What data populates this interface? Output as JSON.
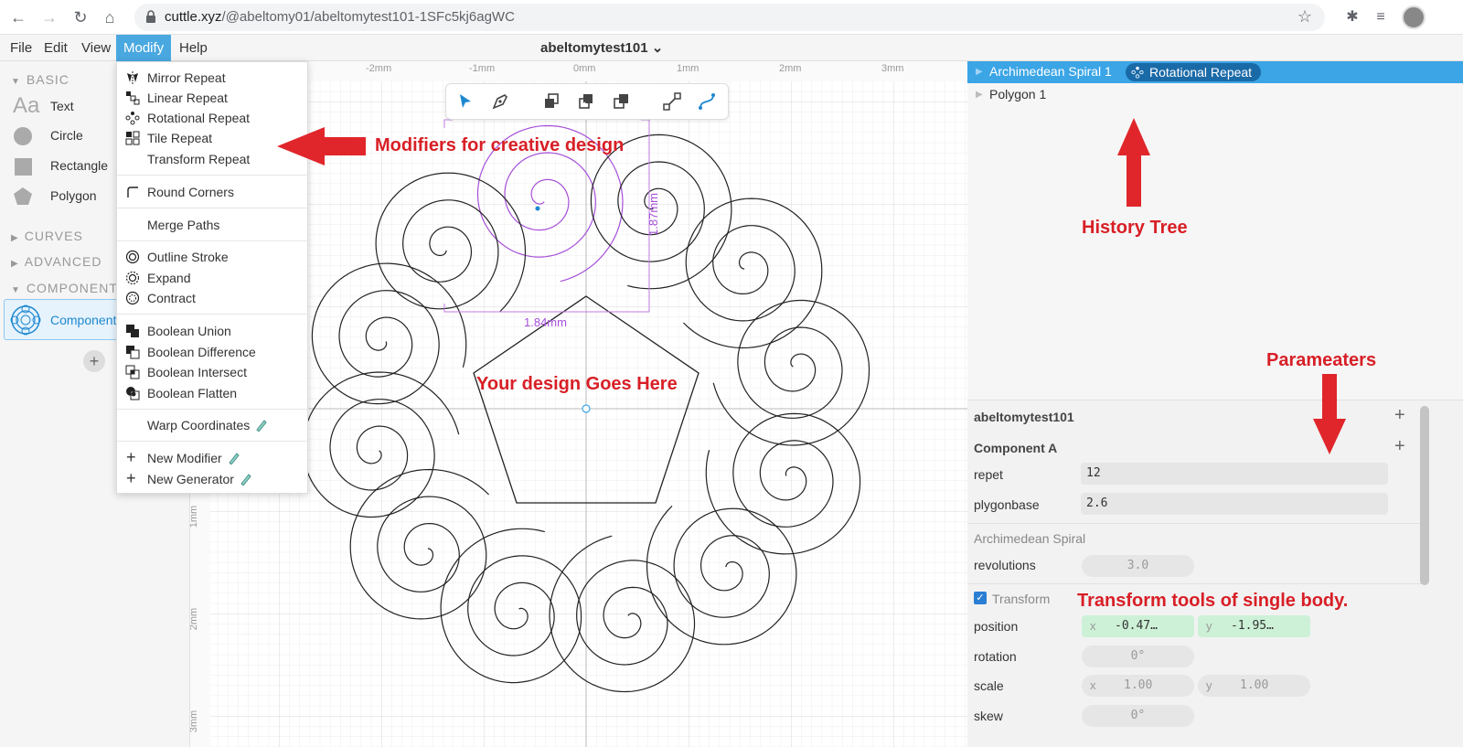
{
  "browser": {
    "url_domain": "cuttle.xyz",
    "url_path": "/@abeltomy01/abeltomytest101-1SFc5kj6agWC"
  },
  "menubar": {
    "items": [
      "File",
      "Edit",
      "View",
      "Modify",
      "Help"
    ],
    "active": "Modify",
    "doc_title": "abeltomytest101",
    "doc_title_chevron": "⌄"
  },
  "left_panel": {
    "basic_header": "BASIC",
    "shapes": [
      "Text",
      "Circle",
      "Rectangle",
      "Polygon"
    ],
    "text_icon": "Aa",
    "curves_header": "CURVES",
    "advanced_header": "ADVANCED",
    "components_header": "COMPONENTS",
    "component_item": "Component A",
    "add_label": "+"
  },
  "modify_menu": {
    "groups": [
      [
        "Mirror Repeat",
        "Linear Repeat",
        "Rotational Repeat",
        "Tile Repeat",
        "Transform Repeat"
      ],
      [
        "Round Corners"
      ],
      [
        "Merge Paths"
      ],
      [
        "Outline Stroke",
        "Expand",
        "Contract"
      ],
      [
        "Boolean Union",
        "Boolean Difference",
        "Boolean Intersect",
        "Boolean Flatten"
      ],
      [
        "Warp Coordinates"
      ],
      [
        "New Modifier",
        "New Generator"
      ]
    ]
  },
  "canvas": {
    "ruler_top": [
      "-2mm",
      "-1mm",
      "0mm",
      "1mm",
      "2mm",
      "3mm"
    ],
    "ruler_left": [
      "1mm",
      "2mm",
      "3mm"
    ],
    "dim_width": "1.84mm",
    "dim_height": "1.87mm",
    "toolbar_tools": [
      "select-arrow",
      "pen",
      "send-back",
      "bring-front",
      "duplicate",
      "node-edit",
      "bezier"
    ]
  },
  "annotations": {
    "modifiers": "Modifiers for creative design",
    "history": "History Tree",
    "design": "Your design Goes Here",
    "params": "Parameaters",
    "transform": "Transform tools of single body."
  },
  "history_tree": {
    "row1": "Archimedean Spiral 1",
    "row1_badge": "Rotational Repeat",
    "row2": "Polygon 1"
  },
  "params": {
    "project": "abeltomytest101",
    "component": "Component A",
    "plus": "+",
    "repet_label": "repet",
    "repet_value": "12",
    "plygonbase_label": "plygonbase",
    "plygonbase_value": "2.6",
    "spiral_header": "Archimedean Spiral",
    "revolutions_label": "revolutions",
    "revolutions_value": "3.0",
    "transform_label": "Transform",
    "position_label": "position",
    "pos_x_axis": "x",
    "pos_x": "-0.47…",
    "pos_y_axis": "y",
    "pos_y": "-1.95…",
    "rotation_label": "rotation",
    "rotation_value": "0°",
    "scale_label": "scale",
    "scale_x_axis": "x",
    "scale_x": "1.00",
    "scale_y_axis": "y",
    "scale_y": "1.00",
    "skew_label": "skew",
    "skew_value": "0°"
  },
  "colors": {
    "accent": "#3ba5e6",
    "annotation": "#d81f26",
    "selection": "#a64fd9",
    "field_green": "#cdf1d7"
  }
}
